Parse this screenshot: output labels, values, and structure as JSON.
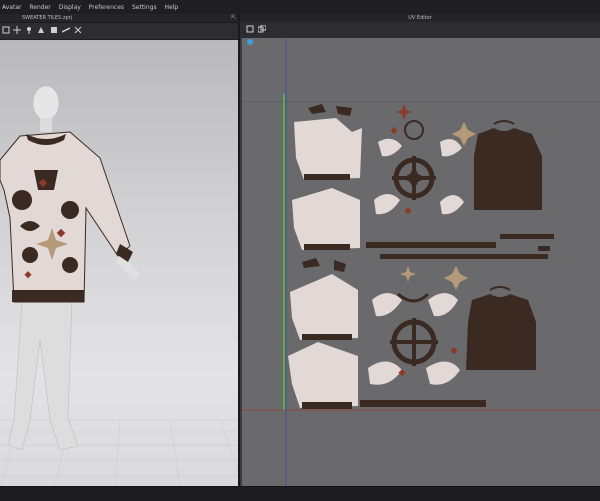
{
  "menu": [
    "Avatar",
    "Render",
    "Display",
    "Preferences",
    "Settings",
    "Help"
  ],
  "left_window": {
    "title": "SWEATER TILES.zprj"
  },
  "uv_editor": {
    "title": "UV Editor"
  },
  "colors": {
    "background": "#6a6a6c",
    "fabric_light": "#e2d8d6",
    "fabric_dark": "#3a2a22",
    "fabric_red": "#8a3a26",
    "fabric_tan": "#b49a78",
    "uv_line_blue": "#3b4fb0",
    "uv_line_red": "#9a3a3a",
    "uv_line_green": "#55c24a"
  }
}
